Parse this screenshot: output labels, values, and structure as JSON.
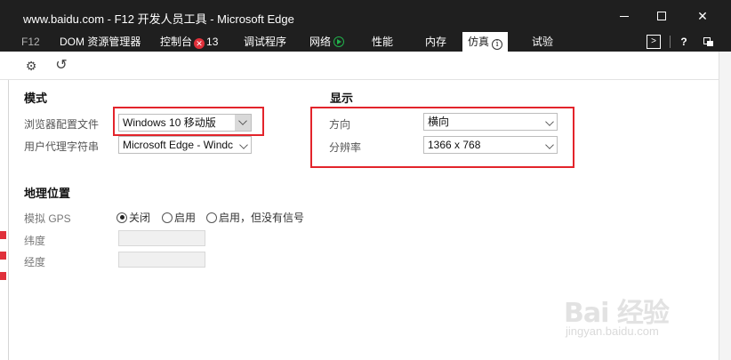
{
  "window": {
    "title": "www.baidu.com - F12 开发人员工具 - Microsoft Edge"
  },
  "tabs": {
    "f12": "F12",
    "dom": "DOM 资源管理器",
    "console": "控制台",
    "console_errors": "13",
    "debugger": "调试程序",
    "network": "网络",
    "performance": "性能",
    "memory": "内存",
    "emulation": "仿真",
    "experiments": "试验"
  },
  "mode": {
    "heading": "模式",
    "browser_profile_label": "浏览器配置文件",
    "browser_profile_value": "Windows 10 移动版",
    "user_agent_label": "用户代理字符串",
    "user_agent_value": "Microsoft Edge - Windc"
  },
  "display": {
    "heading": "显示",
    "orientation_label": "方向",
    "orientation_value": "横向",
    "resolution_label": "分辨率",
    "resolution_value": "1366 x 768"
  },
  "geolocation": {
    "heading": "地理位置",
    "simulate_gps_label": "模拟 GPS",
    "option_off": "关闭",
    "option_on": "启用",
    "option_on_no_signal": "启用，但没有信号",
    "selected": "关闭",
    "latitude_label": "纬度",
    "latitude_value": "",
    "longitude_label": "经度",
    "longitude_value": ""
  },
  "watermark": {
    "brand": "Bai 经验",
    "url": "jingyan.baidu.com"
  },
  "colors": {
    "titlebar": "#1f1f1f",
    "highlight": "#e3242b",
    "error_badge": "#e0303a",
    "network_badge": "#21b14b"
  }
}
